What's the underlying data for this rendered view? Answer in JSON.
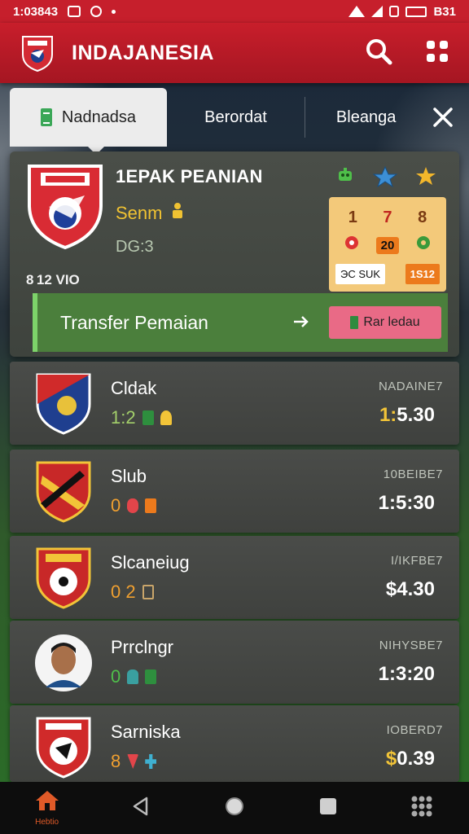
{
  "status_bar": {
    "time": "1:03843",
    "battery_text": "B31"
  },
  "app_bar": {
    "title": "INDAJANESIA",
    "accent_color": "#c81e2b"
  },
  "tabs": [
    {
      "label": "Nadnadsa",
      "active": true
    },
    {
      "label": "Berordat",
      "active": false
    },
    {
      "label": "Bleanga",
      "active": false
    }
  ],
  "featured": {
    "title": "1EPAK PEANIAN",
    "subtitle": "Senm",
    "score": "DG:3",
    "id_text": "8 12 VIO",
    "stats": {
      "row1": [
        "1",
        "7",
        "8"
      ],
      "row2_chip": "20",
      "tag_a": "ЭС SUK",
      "tag_b": "1S12"
    },
    "transfer_label": "Transfer Pemaian",
    "transfer_button": "Rar ledau"
  },
  "clubs": [
    {
      "name": "Cldak",
      "meta": "1:2",
      "code": "NADAINE7",
      "price_prefix": "1:",
      "price_rest": "5.30",
      "accent": true
    },
    {
      "name": "Slub",
      "meta": "0",
      "code": "10BEIBE7",
      "price_prefix": "1:5",
      "price_rest": ":30",
      "accent": false
    },
    {
      "name": "Slcaneiug",
      "meta": "0 2",
      "code": "I/IKFBE7",
      "price_prefix": "$",
      "price_rest": "4.30",
      "accent": false
    },
    {
      "name": "Prrclngr",
      "meta": "0",
      "code": "NIHYSBE7",
      "price_prefix": "1:3",
      "price_rest": ":20",
      "accent": false
    },
    {
      "name": "Sarniska",
      "meta": "8",
      "code": "IOBERD7",
      "price_prefix": "$",
      "price_rest": "0.39",
      "accent": true
    }
  ],
  "bottom_nav": {
    "home_label": "Hebtio"
  }
}
